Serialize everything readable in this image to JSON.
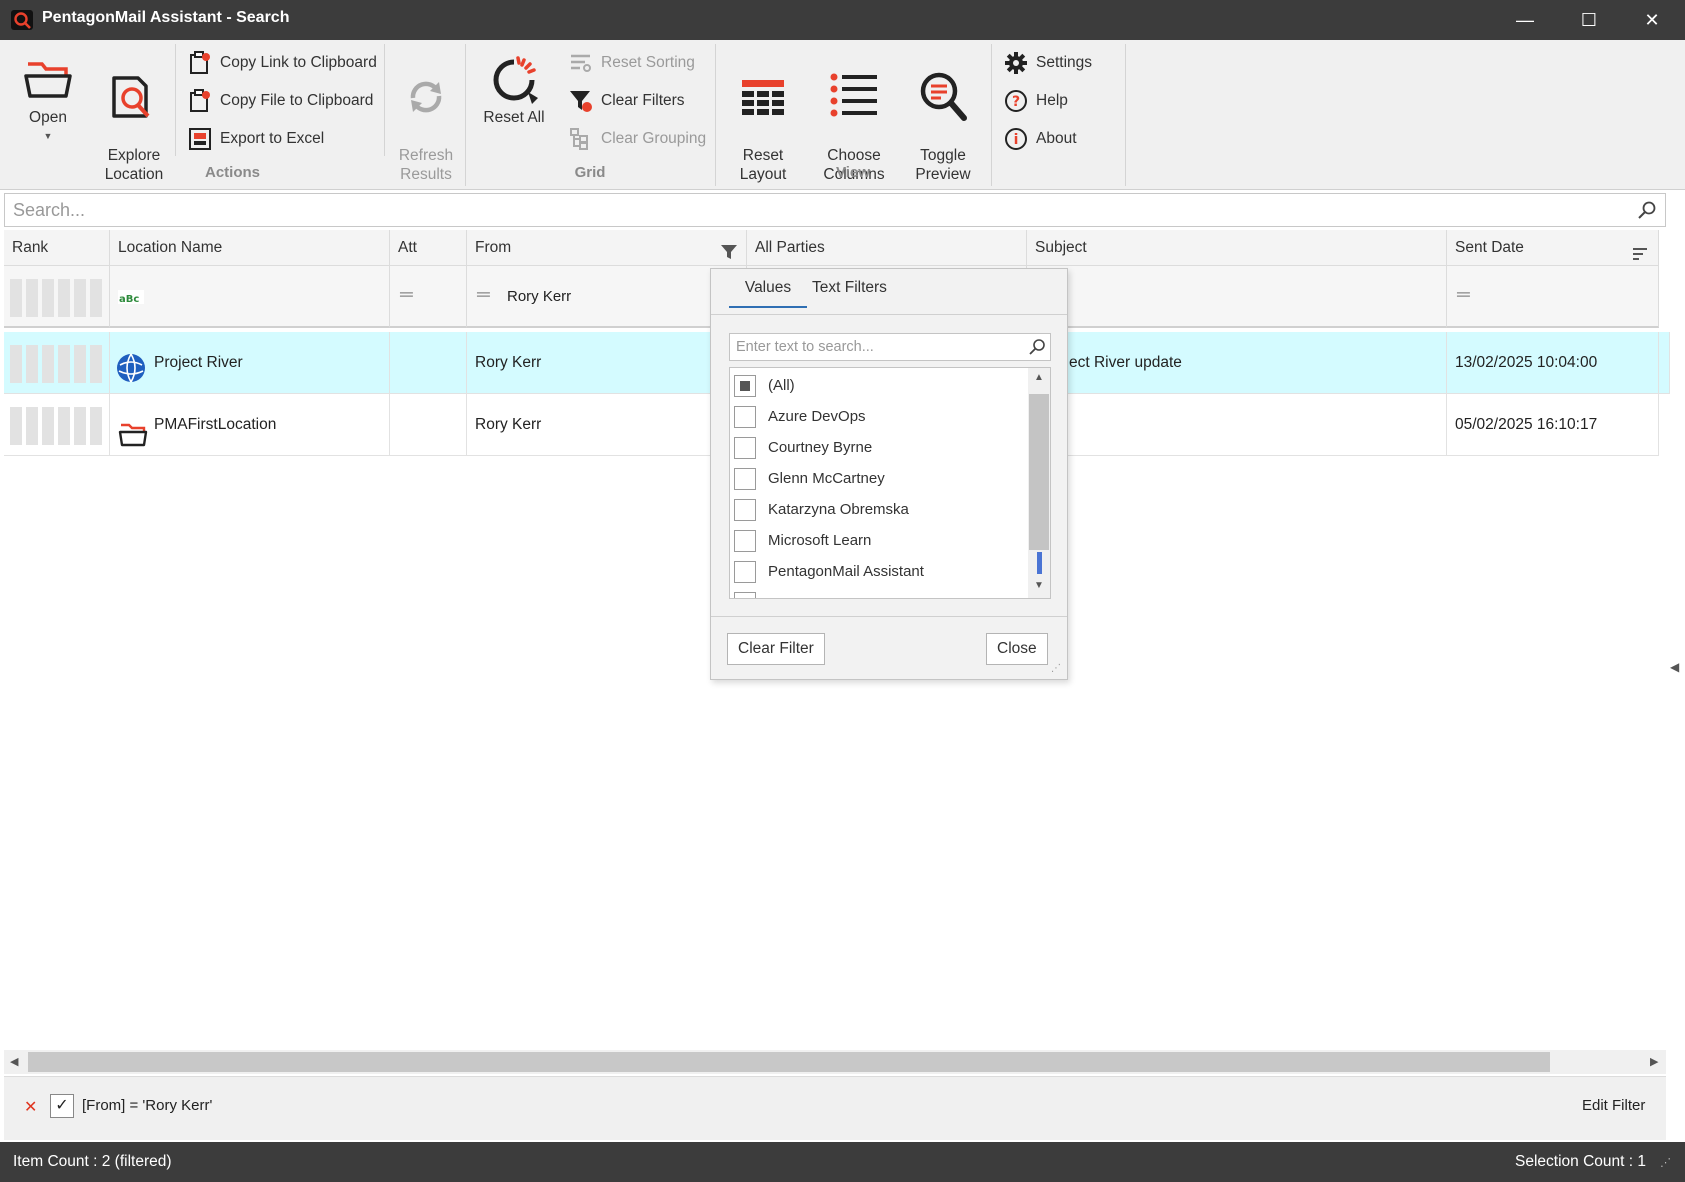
{
  "window": {
    "title": "PentagonMail Assistant - Search",
    "minimize_glyph": "—",
    "maximize_glyph": "☐",
    "close_glyph": "✕"
  },
  "ribbon": {
    "accent_color": "#e8412c",
    "actions": {
      "open_label": "Open",
      "explore_label": "Explore\nLocation",
      "copy_link_label": "Copy Link to Clipboard",
      "copy_file_label": "Copy File to Clipboard",
      "export_excel_label": "Export to Excel",
      "group_label": "Actions"
    },
    "refresh_label": "Refresh\nResults",
    "grid": {
      "reset_all_label": "Reset All",
      "reset_sorting_label": "Reset Sorting",
      "clear_filters_label": "Clear Filters",
      "clear_grouping_label": "Clear Grouping",
      "group_label": "Grid"
    },
    "view": {
      "reset_layout_label": "Reset\nLayout",
      "choose_columns_label": "Choose\nColumns",
      "toggle_preview_label": "Toggle\nPreview",
      "group_label": "View"
    },
    "misc": {
      "settings_label": "Settings",
      "help_label": "Help",
      "about_label": "About"
    }
  },
  "search": {
    "placeholder": "Search..."
  },
  "grid": {
    "columns": [
      "Rank",
      "Location Name",
      "Att",
      "From",
      "All Parties",
      "Subject",
      "Sent Date"
    ],
    "filter_row": {
      "from_value": "Rory Kerr"
    },
    "rows": [
      {
        "location": "Project River",
        "from": "Rory Kerr",
        "subject": "ect River update",
        "sent": "13/02/2025 10:04:00"
      },
      {
        "location": "PMAFirstLocation",
        "from": "Rory Kerr",
        "subject": "",
        "sent": "05/02/2025 16:10:17"
      }
    ]
  },
  "filter_popup": {
    "tabs": [
      "Values",
      "Text Filters"
    ],
    "search_placeholder": "Enter text to search...",
    "values": [
      "(All)",
      "Azure DevOps",
      "Courtney Byrne",
      "Glenn McCartney",
      "Katarzyna Obremska",
      "Microsoft Learn",
      "PentagonMail Assistant"
    ],
    "clear_label": "Clear Filter",
    "close_label": "Close"
  },
  "filter_panel": {
    "expression": "[From] = 'Rory Kerr'",
    "edit_label": "Edit Filter"
  },
  "status": {
    "item_count": "Item Count : 2 (filtered)",
    "selection_count": "Selection Count : 1"
  }
}
